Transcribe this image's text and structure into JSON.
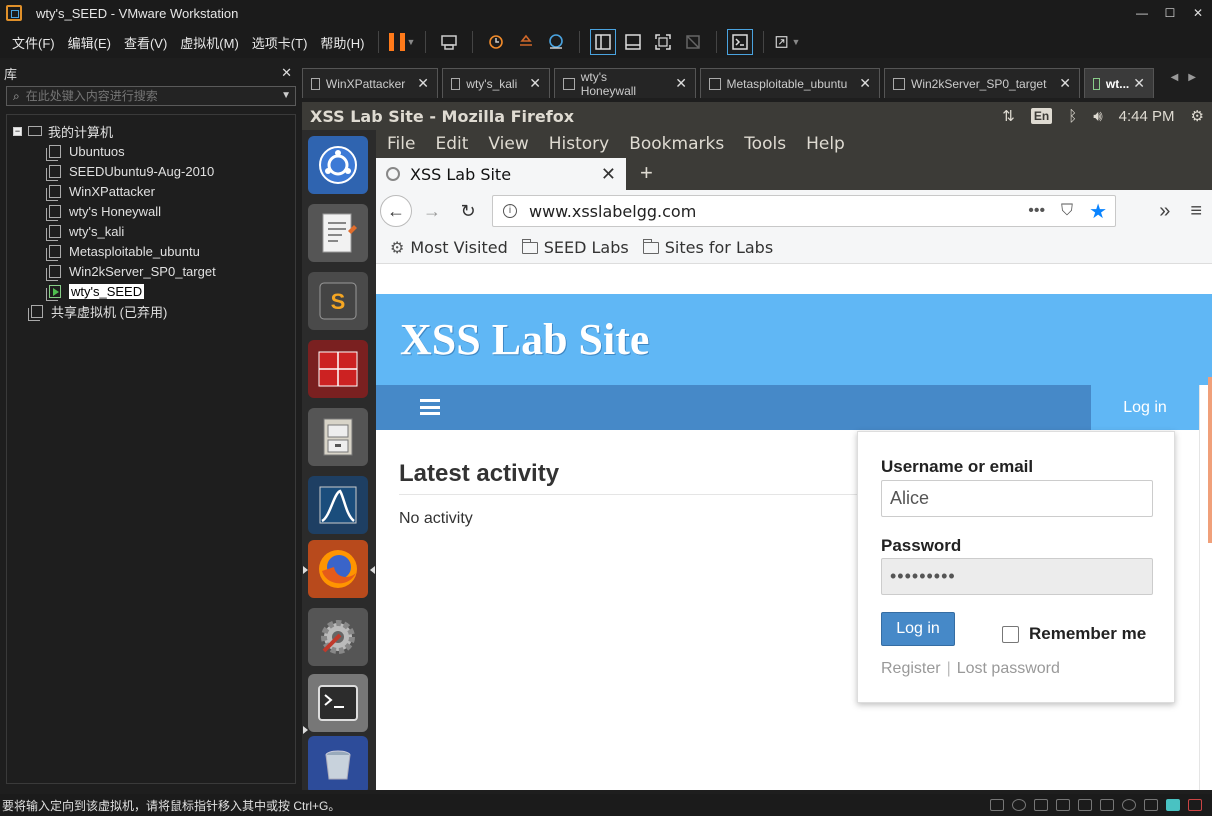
{
  "window": {
    "title": "wty's_SEED - VMware Workstation"
  },
  "menu": [
    "文件(F)",
    "编辑(E)",
    "查看(V)",
    "虚拟机(M)",
    "选项卡(T)",
    "帮助(H)"
  ],
  "library": {
    "title": "库",
    "search_placeholder": "在此处键入内容进行搜索",
    "root": "我的计算机",
    "vms": [
      "Ubuntuos",
      "SEEDUbuntu9-Aug-2010",
      "WinXPattacker",
      "wty's Honeywall",
      "wty's_kali",
      "Metasploitable_ubuntu",
      "Win2kServer_SP0_target"
    ],
    "selected_vm": "wty's_SEED",
    "shared": "共享虚拟机 (已弃用)"
  },
  "vm_tabs": [
    "WinXPattacker",
    "wty's_kali",
    "wty's Honeywall",
    "Metasploitable_ubuntu",
    "Win2kServer_SP0_target",
    "wt..."
  ],
  "ubuntu": {
    "window_title": "XSS Lab Site - Mozilla Firefox",
    "lang": "En",
    "time": "4:44 PM"
  },
  "firefox": {
    "menu": [
      "File",
      "Edit",
      "View",
      "History",
      "Bookmarks",
      "Tools",
      "Help"
    ],
    "tab_title": "XSS Lab Site",
    "url": "www.xsslabelgg.com",
    "bookmarks": [
      "Most Visited",
      "SEED Labs",
      "Sites for Labs"
    ]
  },
  "site": {
    "title": "XSS Lab Site",
    "nav_login": "Log in",
    "activity_heading": "Latest activity",
    "activity_empty": "No activity",
    "login": {
      "username_label": "Username or email",
      "username_value": "Alice",
      "password_label": "Password",
      "password_mask": "•••••••••",
      "button": "Log in",
      "remember": "Remember me",
      "register": "Register",
      "lost_password": "Lost password"
    }
  },
  "status": {
    "message": "要将输入定向到该虚拟机，请将鼠标指针移入其中或按 Ctrl+G。"
  }
}
